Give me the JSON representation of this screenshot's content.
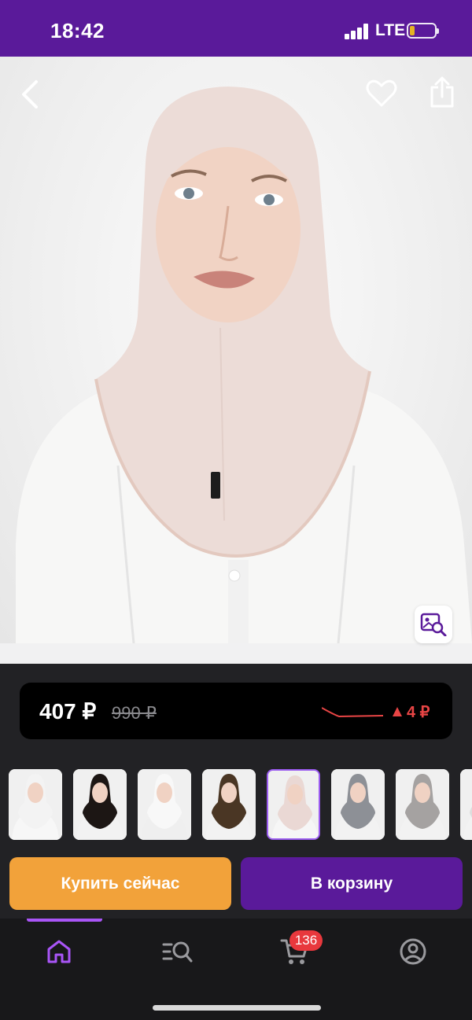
{
  "status_bar": {
    "time": "18:42",
    "network": "LTE",
    "battery_level": 0.2,
    "colors": {
      "bar": "#5a1a9a",
      "battery": "#f5c518"
    }
  },
  "product": {
    "image_icon": "hijab-model-photo",
    "nav": {
      "back_icon": "chevron-left-icon",
      "favorite_icon": "heart-icon",
      "share_icon": "share-icon",
      "photo_search_icon": "image-search-icon"
    }
  },
  "price": {
    "current": "407 ₽",
    "old": "990 ₽",
    "change": "4 ₽",
    "change_direction": "up",
    "colors": {
      "change": "#e84545",
      "card": "#000000"
    }
  },
  "variants": [
    {
      "name": "white-long",
      "hood": "#f3f3f3",
      "shirt": "#f7f7f7"
    },
    {
      "name": "black",
      "hood": "#1c1614",
      "shirt": "#f2f2f2"
    },
    {
      "name": "white",
      "hood": "#f8f8f8",
      "shirt": "#efefef"
    },
    {
      "name": "brown",
      "hood": "#4a3624",
      "shirt": "#f2f2f2"
    },
    {
      "name": "powder",
      "hood": "#ead8d4",
      "shirt": "#f6f6f6",
      "selected": true
    },
    {
      "name": "grey",
      "hood": "#8d9096",
      "shirt": "#f2f2f2"
    },
    {
      "name": "light-grey",
      "hood": "#a5a2a1",
      "shirt": "#f2f2f2"
    },
    {
      "name": "partial",
      "hood": "#dddddd",
      "shirt": "#f2f2f2"
    }
  ],
  "actions": {
    "buy_now": "Купить сейчас",
    "add_to_cart": "В корзину",
    "colors": {
      "buy_now": "#f2a23a",
      "add_to_cart": "#5a1a9a"
    }
  },
  "tab_bar": {
    "items": [
      {
        "id": "home",
        "icon": "home-icon",
        "active": true
      },
      {
        "id": "catalog",
        "icon": "catalog-search-icon"
      },
      {
        "id": "cart",
        "icon": "cart-icon"
      },
      {
        "id": "profile",
        "icon": "profile-icon"
      }
    ],
    "cart_badge": "136",
    "colors": {
      "active": "#a955f7",
      "inactive": "#9a9a9e",
      "badge": "#e8383d"
    }
  }
}
